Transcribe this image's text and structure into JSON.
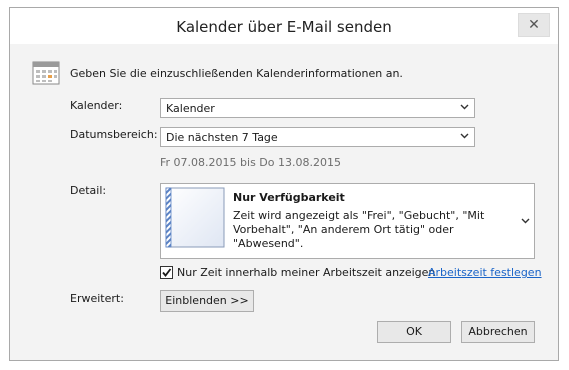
{
  "dialog": {
    "title": "Kalender über E-Mail senden",
    "close_glyph": "✕",
    "instruction": "Geben Sie die einzuschließenden Kalenderinformationen an."
  },
  "calendar": {
    "label": "Kalender:",
    "value": "Kalender"
  },
  "date_range": {
    "label": "Datumsbereich:",
    "value": "Die nächsten 7 Tage",
    "range_text": "Fr 07.08.2015 bis Do 13.08.2015"
  },
  "detail": {
    "label": "Detail:",
    "option_title": "Nur Verfügbarkeit",
    "option_description": "Zeit wird angezeigt als \"Frei\", \"Gebucht\", \"Mit Vorbehalt\", \"An anderem Ort tätig\" oder \"Abwesend\"."
  },
  "working_hours": {
    "checkbox_label": "Nur Zeit innerhalb meiner Arbeitszeit anzeigen",
    "checked": true,
    "link": "Arbeitszeit festlegen"
  },
  "advanced": {
    "label": "Erweitert:",
    "button": "Einblenden >>"
  },
  "buttons": {
    "ok": "OK",
    "cancel": "Abbrechen"
  },
  "icons": {
    "calendar": "calendar-icon",
    "availability": "availability-document-icon",
    "close": "close-icon",
    "chevron": "chevron-down-icon",
    "check": "checkmark-icon"
  },
  "colors": {
    "dialog_background": "#f3f3f3",
    "link": "#1a64c8",
    "border": "#acacac"
  }
}
